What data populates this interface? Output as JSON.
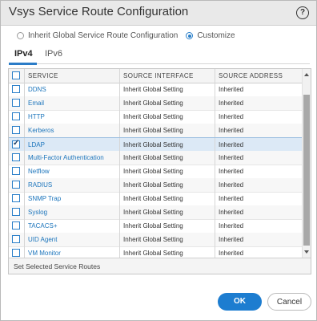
{
  "dialog": {
    "title": "Vsys Service Route Configuration",
    "help_icon": "help-icon"
  },
  "radios": {
    "inherit_label": "Inherit Global Service Route Configuration",
    "customize_label": "Customize",
    "selected": "Customize"
  },
  "tabs": [
    {
      "label": "IPv4",
      "active": true
    },
    {
      "label": "IPv6",
      "active": false
    }
  ],
  "table": {
    "headers": [
      "SERVICE",
      "SOURCE INTERFACE",
      "SOURCE ADDRESS"
    ],
    "rows": [
      {
        "service": "DDNS",
        "interface": "Inherit Global Setting",
        "address": "Inherited",
        "checked": false
      },
      {
        "service": "Email",
        "interface": "Inherit Global Setting",
        "address": "Inherited",
        "checked": false
      },
      {
        "service": "HTTP",
        "interface": "Inherit Global Setting",
        "address": "Inherited",
        "checked": false
      },
      {
        "service": "Kerberos",
        "interface": "Inherit Global Setting",
        "address": "Inherited",
        "checked": false
      },
      {
        "service": "LDAP",
        "interface": "Inherit Global Setting",
        "address": "Inherited",
        "checked": true
      },
      {
        "service": "Multi-Factor Authentication",
        "interface": "Inherit Global Setting",
        "address": "Inherited",
        "checked": false
      },
      {
        "service": "Netflow",
        "interface": "Inherit Global Setting",
        "address": "Inherited",
        "checked": false
      },
      {
        "service": "RADIUS",
        "interface": "Inherit Global Setting",
        "address": "Inherited",
        "checked": false
      },
      {
        "service": "SNMP Trap",
        "interface": "Inherit Global Setting",
        "address": "Inherited",
        "checked": false
      },
      {
        "service": "Syslog",
        "interface": "Inherit Global Setting",
        "address": "Inherited",
        "checked": false
      },
      {
        "service": "TACACS+",
        "interface": "Inherit Global Setting",
        "address": "Inherited",
        "checked": false
      },
      {
        "service": "UID Agent",
        "interface": "Inherit Global Setting",
        "address": "Inherited",
        "checked": false
      },
      {
        "service": "VM Monitor",
        "interface": "Inherit Global Setting",
        "address": "Inherited",
        "checked": false
      }
    ],
    "footer_label": "Set Selected Service Routes"
  },
  "buttons": {
    "ok": "OK",
    "cancel": "Cancel"
  },
  "colors": {
    "accent": "#1d7dd0",
    "link": "#1c75bc",
    "selected_row": "#dce9f6"
  }
}
